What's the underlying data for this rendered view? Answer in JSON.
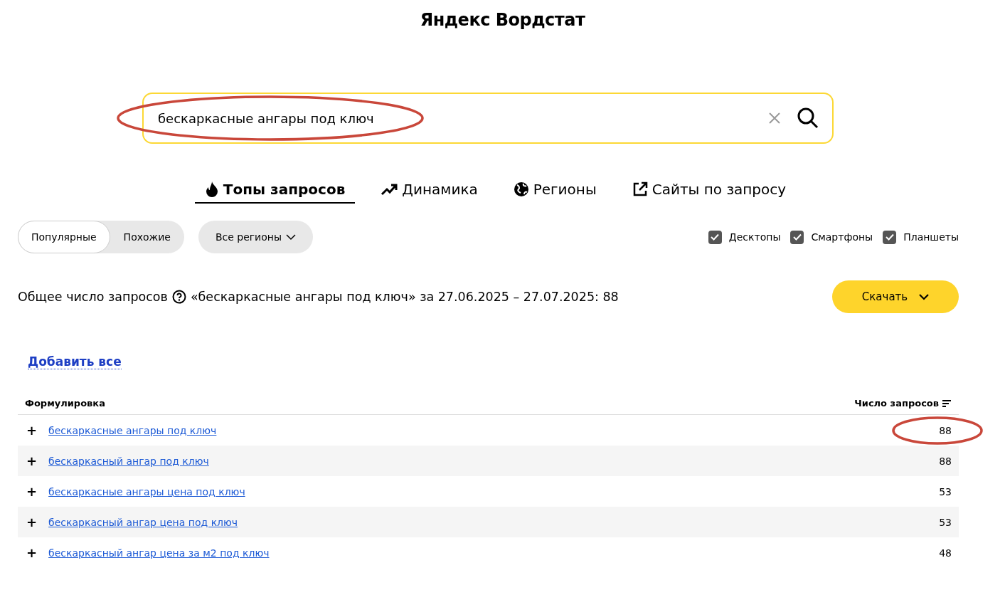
{
  "logo": "Яндекс Вордстат",
  "search": {
    "value": "бескаркасные ангары под ключ",
    "highlighted": true
  },
  "tabs": [
    {
      "label": "Топы запросов",
      "selected": true
    },
    {
      "label": "Динамика",
      "selected": false
    },
    {
      "label": "Регионы",
      "selected": false
    },
    {
      "label": "Сайты по запросу",
      "selected": false
    }
  ],
  "mode_switch": [
    {
      "label": "Популярные",
      "selected": true
    },
    {
      "label": "Похожие",
      "selected": false
    }
  ],
  "region_select": "Все регионы",
  "devices": [
    {
      "label": "Десктопы",
      "checked": true
    },
    {
      "label": "Смартфоны",
      "checked": true
    },
    {
      "label": "Планшеты",
      "checked": true
    }
  ],
  "summary": {
    "label": "Общее число запросов",
    "text": "«бескаркасные ангары под ключ» за 27.06.2025 – 27.07.2025: 88"
  },
  "download_button": "Скачать",
  "add_all_link": "Добавить все",
  "table": {
    "columns": [
      "Формулировка",
      "Число запросов"
    ],
    "rows": [
      {
        "add": "+",
        "phrase": "бескаркасные ангары под ключ",
        "count": "88",
        "highlighted": true
      },
      {
        "add": "+",
        "phrase": "бескаркасный ангар под ключ",
        "count": "88",
        "highlighted": false
      },
      {
        "add": "+",
        "phrase": "бескаркасные ангары цена под ключ",
        "count": "53",
        "highlighted": false
      },
      {
        "add": "+",
        "phrase": "бескаркасный ангар цена под ключ",
        "count": "53",
        "highlighted": false
      },
      {
        "add": "+",
        "phrase": "бескаркасный ангар цена за м2 под ключ",
        "count": "48",
        "highlighted": false
      }
    ]
  }
}
